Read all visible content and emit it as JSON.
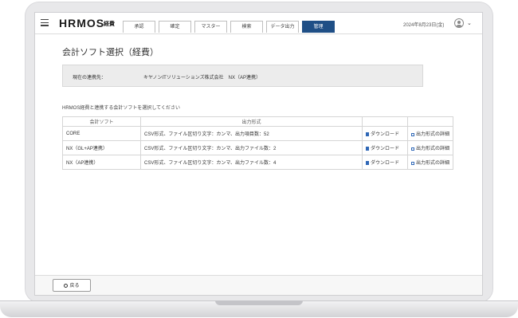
{
  "header": {
    "logo_text": "HRMOS",
    "logo_sub": "経費",
    "tabs": [
      {
        "label": "承認"
      },
      {
        "label": "確定"
      },
      {
        "label": "マスター"
      },
      {
        "label": "検索"
      },
      {
        "label": "データ出力"
      },
      {
        "label": "管理",
        "active": true
      }
    ],
    "date": "2024年8月23日(金)"
  },
  "main": {
    "title": "会計ソフト選択（経費）",
    "connection_label": "現在の連携先：",
    "connection_value": "キヤノンITソリューションズ株式会社　NX（AP連携）",
    "instruction": "HRMOS経費と連携する会計ソフトを選択してください",
    "table": {
      "headers": [
        "会計ソフト",
        "出力形式",
        "",
        ""
      ],
      "rows": [
        {
          "software": "CORE",
          "format": "CSV形式、ファイル区切り文字：カンマ、出力項目数：52",
          "download": "ダウンロード",
          "details": "出力形式の詳細"
        },
        {
          "software": "NX（GL+AP連携）",
          "format": "CSV形式、ファイル区切り文字：カンマ、出力ファイル数：2",
          "download": "ダウンロード",
          "details": "出力形式の詳細"
        },
        {
          "software": "NX（AP連携）",
          "format": "CSV形式、ファイル区切り文字：カンマ、出力ファイル数：4",
          "download": "ダウンロード",
          "details": "出力形式の詳細"
        }
      ]
    }
  },
  "footer": {
    "back_label": "戻る"
  },
  "colors": {
    "accent": "#1f4f86",
    "link": "#2f67b6"
  }
}
